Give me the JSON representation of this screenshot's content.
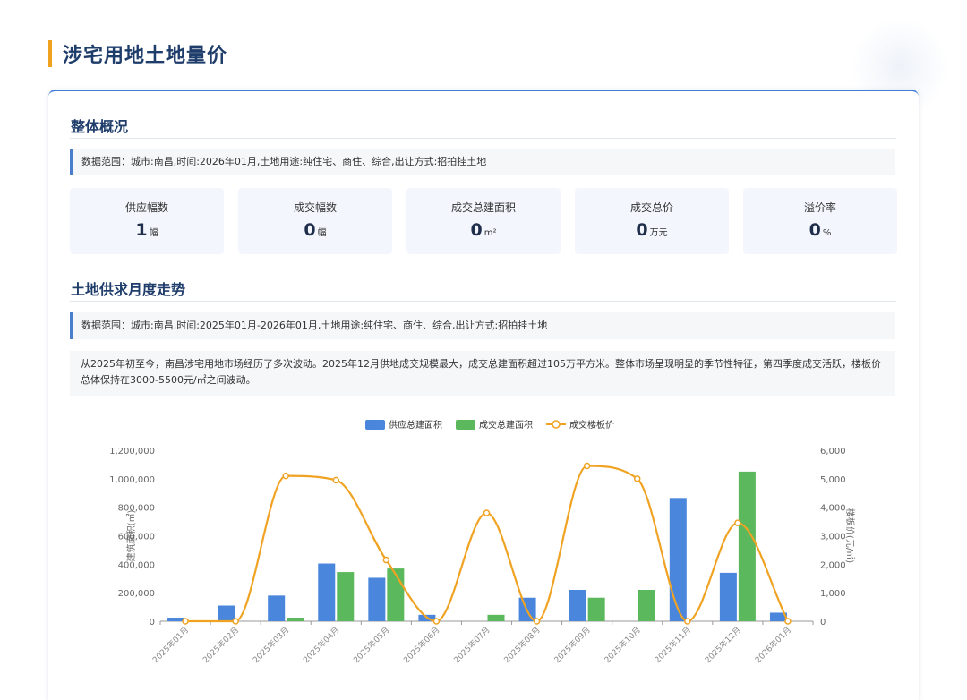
{
  "page_title": "涉宅用地土地量价",
  "overview": {
    "title": "整体概况",
    "range_text": "数据范围：城市:南昌,时间:2026年01月,土地用途:纯住宅、商住、综合,出让方式:招拍挂土地",
    "stats": [
      {
        "label": "供应幅数",
        "value": "1",
        "unit": "幅"
      },
      {
        "label": "成交幅数",
        "value": "0",
        "unit": "幅"
      },
      {
        "label": "成交总建面积",
        "value": "0",
        "unit": "m²"
      },
      {
        "label": "成交总价",
        "value": "0",
        "unit": "万元"
      },
      {
        "label": "溢价率",
        "value": "0",
        "unit": "%"
      }
    ]
  },
  "trend": {
    "title": "土地供求月度走势",
    "range_text": "数据范围：城市:南昌,时间:2025年01月-2026年01月,土地用途:纯住宅、商住、综合,出让方式:招拍挂土地",
    "summary": "从2025年初至今，南昌涉宅用地市场经历了多次波动。2025年12月供地成交规模最大，成交总建面积超过105万平方米。整体市场呈现明显的季节性特征，第四季度成交活跃，楼板价总体保持在3000-5500元/㎡之间波动。"
  },
  "chart_data": {
    "type": "bar",
    "categories": [
      "2025年01月",
      "2025年02月",
      "2025年03月",
      "2025年04月",
      "2025年05月",
      "2025年06月",
      "2025年07月",
      "2025年08月",
      "2025年09月",
      "2025年10月",
      "2025年11月",
      "2025年12月",
      "2026年01月"
    ],
    "series": [
      {
        "name": "供应总建面积",
        "type": "bar",
        "axis": "left",
        "color": "#4a86dc",
        "values": [
          25000,
          110000,
          180000,
          405000,
          305000,
          45000,
          0,
          165000,
          220000,
          0,
          865000,
          340000,
          60000
        ]
      },
      {
        "name": "成交总建面积",
        "type": "bar",
        "axis": "left",
        "color": "#5cb85c",
        "values": [
          0,
          0,
          25000,
          345000,
          370000,
          0,
          45000,
          0,
          165000,
          220000,
          0,
          1050000,
          0
        ]
      },
      {
        "name": "成交楼板价",
        "type": "line",
        "axis": "right",
        "color": "#f0a323",
        "values": [
          0,
          0,
          5100,
          4950,
          2150,
          0,
          3800,
          0,
          5450,
          5000,
          0,
          3450,
          0
        ]
      }
    ],
    "ylabel": "建筑面积(㎡)",
    "y2label": "楼板价(元/㎡)",
    "ylim": [
      0,
      1200000
    ],
    "y2lim": [
      0,
      6000
    ],
    "yticks": [
      "0",
      "200,000",
      "400,000",
      "600,000",
      "800,000",
      "1,000,000",
      "1,200,000"
    ],
    "y2ticks": [
      "0",
      "1,000",
      "2,000",
      "3,000",
      "4,000",
      "5,000",
      "6,000"
    ],
    "grid": false,
    "legend": "top-center"
  }
}
